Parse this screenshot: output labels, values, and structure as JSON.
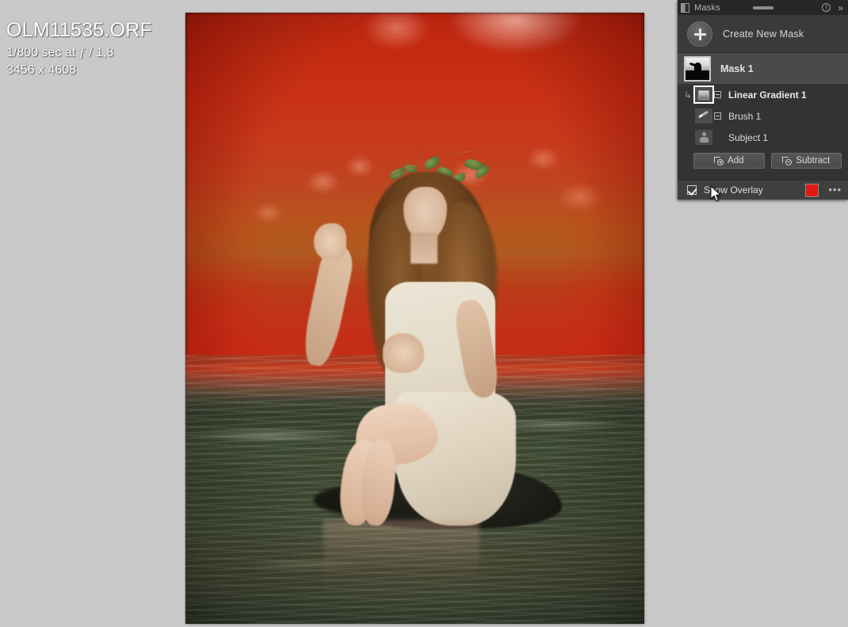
{
  "photo_info": {
    "file_name": "OLM11535.ORF",
    "exposure_prefix": "1/800 sec at",
    "f_glyph": "ƒ",
    "aperture": "/ 1,8",
    "dimensions": "3456 x 4608"
  },
  "masks_panel": {
    "title": "Masks",
    "icons": {
      "panel": "split-square-icon",
      "drag": "drag-handle-icon",
      "info": "info-icon",
      "collapse": "double-chevron-right-icon"
    },
    "info_glyph": "!",
    "collapse_glyph": "»",
    "create_new_mask": {
      "label": "Create New Mask",
      "icon": "plus-icon"
    },
    "mask_items": [
      {
        "label": "Mask 1",
        "type": "mask-group",
        "icon": "mask-thumbnail"
      },
      {
        "label": "Linear Gradient 1",
        "type": "child",
        "icon": "linear-gradient-icon",
        "arrow": "↳",
        "selected": true
      },
      {
        "label": "Brush 1",
        "type": "child",
        "icon": "brush-icon",
        "selected": false
      },
      {
        "label": "Subject 1",
        "type": "child",
        "icon": "subject-person-icon",
        "selected": false
      }
    ],
    "buttons": {
      "add": {
        "label": "Add",
        "icon": "add-mask-icon"
      },
      "subtract": {
        "label": "Subtract",
        "icon": "subtract-mask-icon"
      }
    },
    "overlay": {
      "checkbox_label": "Show Overlay",
      "checked": true,
      "color": "#e01b16",
      "more_glyph": "•••"
    }
  },
  "colors": {
    "app_background": "#c9c9c9",
    "panel_background": "#3a3a3a",
    "panel_titlebar": "#272727",
    "list_background": "#333333",
    "row_highlight": "#4a4a4a",
    "overlay_red": "#e01b16",
    "text_primary": "#dedede"
  }
}
